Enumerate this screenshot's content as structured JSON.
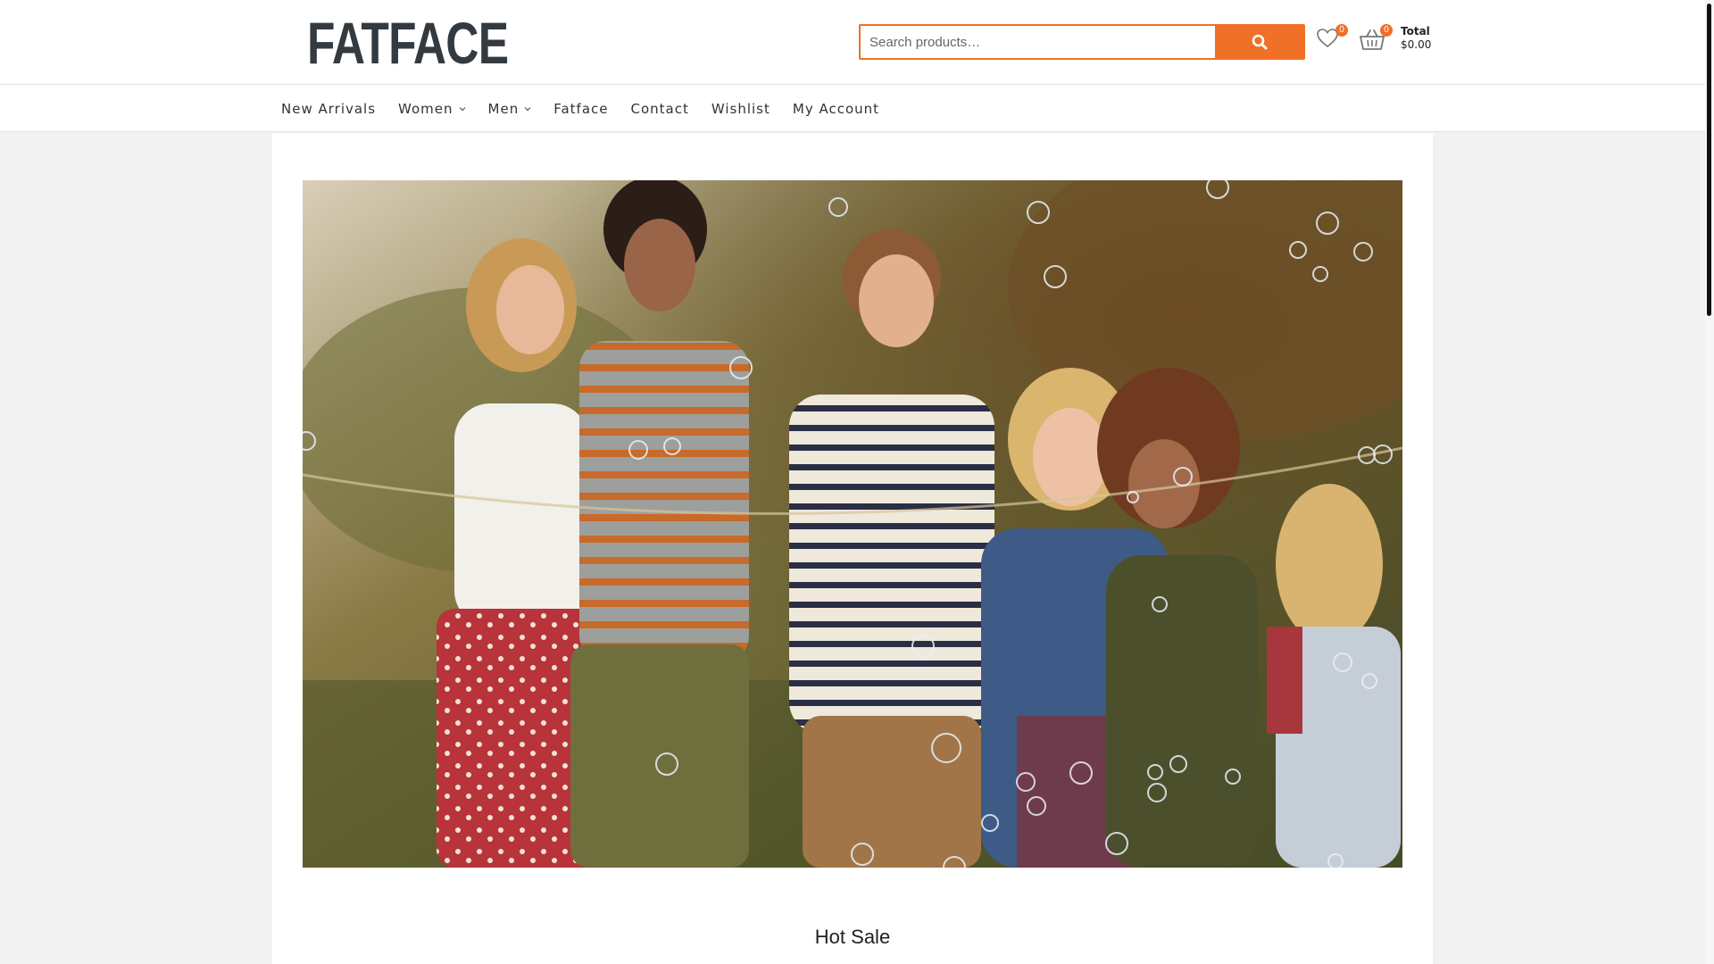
{
  "brand": {
    "logo_text": "FATFACE"
  },
  "search": {
    "placeholder": "Search products…",
    "button_icon": "search-icon"
  },
  "wishlist": {
    "count": "0",
    "icon": "heart-icon"
  },
  "cart": {
    "count": "0",
    "icon": "basket-icon",
    "total_label": "Total",
    "total_value": "$0.00"
  },
  "nav": {
    "items": [
      {
        "label": "New Arrivals",
        "dropdown": false
      },
      {
        "label": "Women",
        "dropdown": true
      },
      {
        "label": "Men",
        "dropdown": true
      },
      {
        "label": "Fatface",
        "dropdown": false
      },
      {
        "label": "Contact",
        "dropdown": false
      },
      {
        "label": "Wishlist",
        "dropdown": false
      },
      {
        "label": "My Account",
        "dropdown": false
      }
    ]
  },
  "hero": {
    "description": ""
  },
  "sections": {
    "hot_sale_title": "Hot Sale"
  },
  "colors": {
    "accent": "#f07028",
    "logo": "#333a40",
    "page_bg": "#f2f2f2"
  }
}
